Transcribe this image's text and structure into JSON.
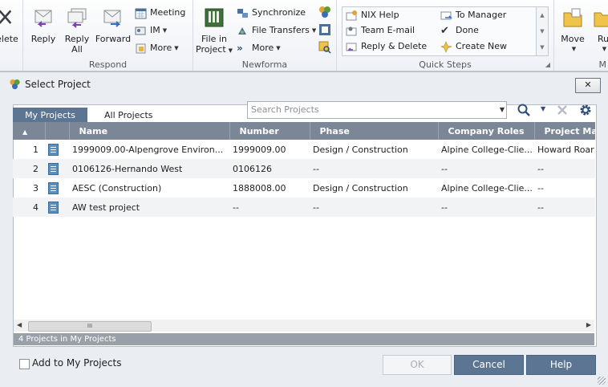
{
  "ribbon": {
    "delete_label": "elete",
    "respond": {
      "title": "Respond",
      "reply": "Reply",
      "reply_all_line1": "Reply",
      "reply_all_line2": "All",
      "forward": "Forward",
      "meeting": "Meeting",
      "im": "IM",
      "more": "More"
    },
    "newforma": {
      "title": "Newforma",
      "file_in_project_line1": "File in",
      "file_in_project_line2": "Project",
      "synchronize": "Synchronize",
      "file_transfers": "File Transfers",
      "more": "More"
    },
    "quick_steps": {
      "title": "Quick Steps",
      "items": [
        "NIX Help",
        "To Manager",
        "Team E-mail",
        "Done",
        "Reply & Delete",
        "Create New"
      ]
    },
    "move": "Move",
    "rules": "Ru",
    "next_group_initial": "M"
  },
  "dialog": {
    "title": "Select Project",
    "close": "✕",
    "tabs": [
      "My Projects",
      "All Projects"
    ],
    "search_placeholder": "Search Projects",
    "columns": [
      "Name",
      "Number",
      "Phase",
      "Company Roles",
      "Project Ma"
    ],
    "rows": [
      {
        "idx": "1",
        "name": "1999009.00-Alpengrove Environ...",
        "number": "1999009.00",
        "phase": "Design / Construction",
        "roles": "Alpine College-Clie...",
        "pm": "Howard Roar"
      },
      {
        "idx": "2",
        "name": "0106126-Hernando West",
        "number": "0106126",
        "phase": "--",
        "roles": "--",
        "pm": "--"
      },
      {
        "idx": "3",
        "name": "AESC (Construction)",
        "number": "1888008.00",
        "phase": "Design / Construction",
        "roles": "Alpine College-Clie...",
        "pm": "--"
      },
      {
        "idx": "4",
        "name": "AW test project",
        "number": "--",
        "phase": "--",
        "roles": "--",
        "pm": "--"
      }
    ],
    "scroll_thumb_label": "III",
    "status": "4 Projects in My Projects",
    "add_to_my_projects": "Add to My Projects",
    "ok": "OK",
    "cancel": "Cancel",
    "help": "Help"
  },
  "colors": {
    "accent": "#5c7592",
    "header": "#7b8797",
    "status": "#9aa0a8"
  }
}
